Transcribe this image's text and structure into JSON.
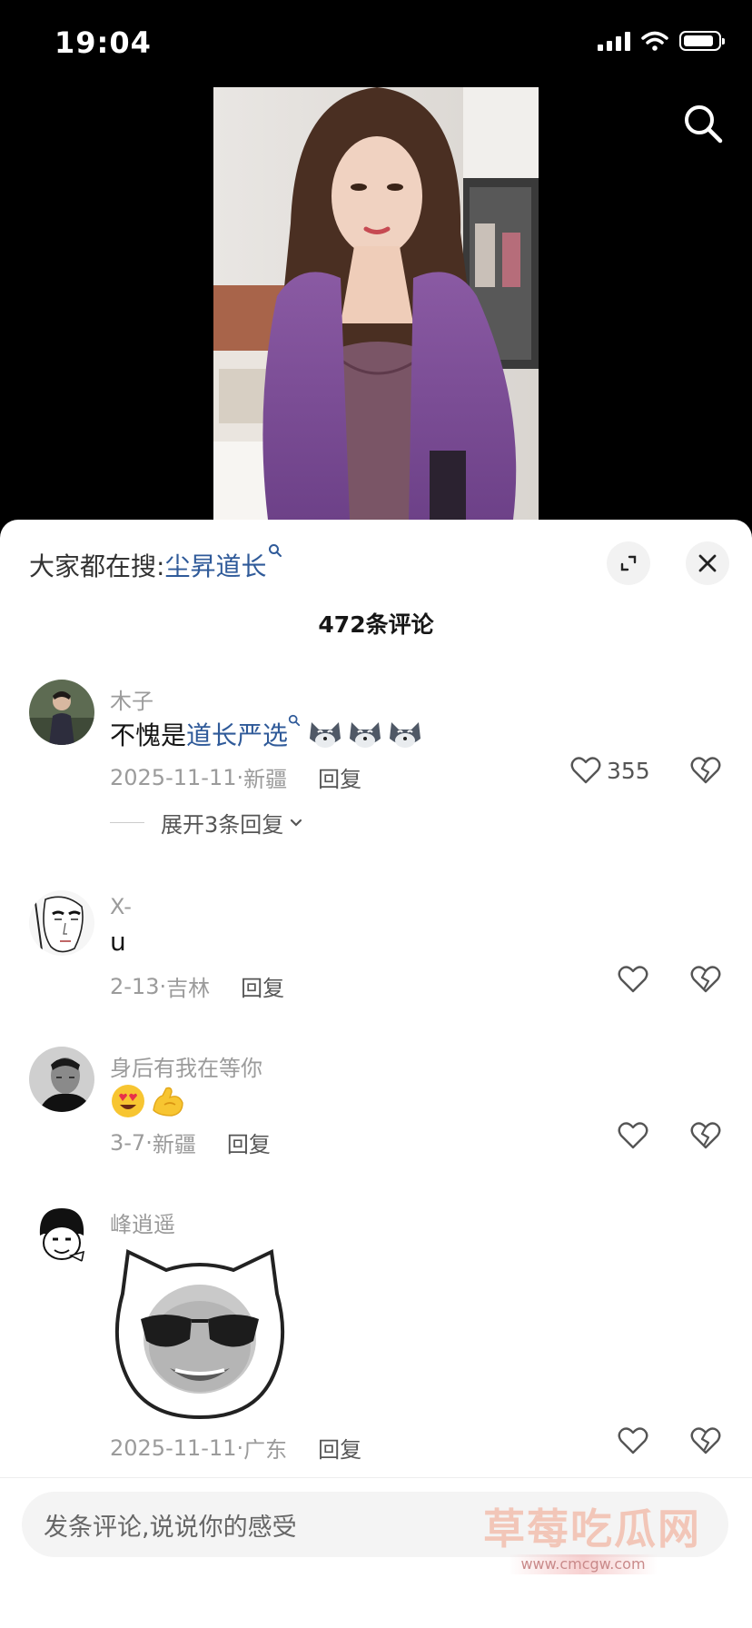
{
  "status_bar": {
    "time": "19:04"
  },
  "hot_search": {
    "label": "大家都在搜:",
    "keyword": "尘昇道长"
  },
  "comment_count": "472条评论",
  "comments": [
    {
      "username": "木子",
      "text_prefix": "不愧是",
      "text_link": "道长严选",
      "emojis": [
        "husky",
        "husky",
        "husky"
      ],
      "date": "2025-11-11",
      "location": "新疆",
      "reply": "回复",
      "likes": "355",
      "expand": "展开3条回复"
    },
    {
      "username": "X-",
      "text": "u",
      "date": "2-13",
      "location": "吉林",
      "reply": "回复"
    },
    {
      "username": "身后有我在等你",
      "emojis": [
        "heart-eyes",
        "flexed-biceps"
      ],
      "date": "3-7",
      "location": "新疆",
      "reply": "回复"
    },
    {
      "username": "峰逍遥",
      "sticker": "sunglasses-face-sticker",
      "date": "2025-11-11",
      "location": "广东",
      "reply": "回复"
    }
  ],
  "input": {
    "placeholder": "发条评论,说说你的感受"
  },
  "watermark": {
    "title": "草莓吃瓜网",
    "url": "www.cmcgw.com"
  },
  "colors": {
    "link": "#2f5a99",
    "muted": "#9b9b9b",
    "background": "#000000",
    "sheet": "#ffffff"
  }
}
